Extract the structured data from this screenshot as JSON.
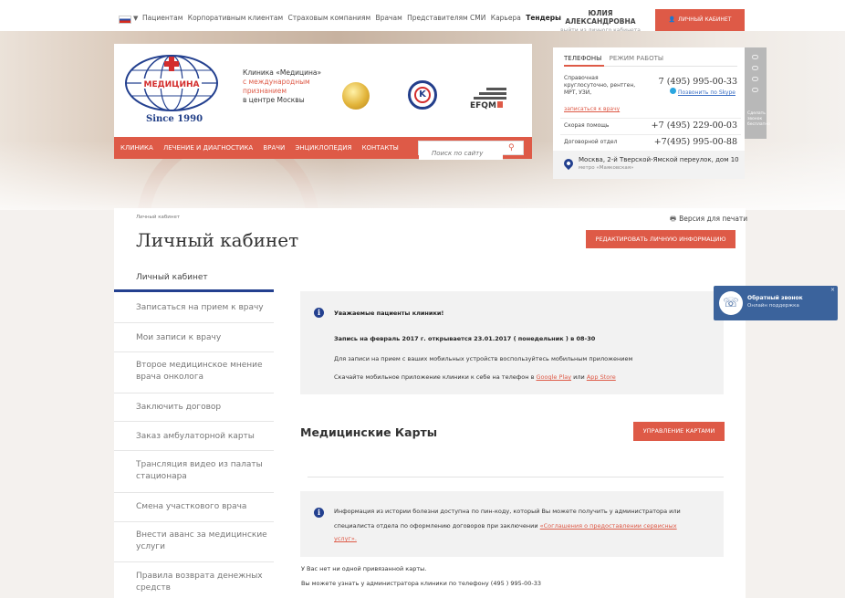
{
  "topbar": {
    "links": [
      "Пациентам",
      "Корпоративным клиентам",
      "Страховым компаниям",
      "Врачам",
      "Представителям СМИ",
      "Карьера"
    ],
    "bold_link": "Тендеры",
    "user_name": "ЮЛИЯ АЛЕКСАНДРОВНА",
    "user_sub": "выйти из личного кабинета",
    "cabinet_button": "ЛИЧНЫЙ КАБИНЕТ"
  },
  "header": {
    "logo_since": "Since 1990",
    "logo_brand": "МЕДИЦИНА",
    "clinic_line1": "Клиника «Медицина»",
    "clinic_line2": "с международным",
    "clinic_line3": "признанием",
    "clinic_line4": "в центре Москвы",
    "badge2_letter": "K",
    "efqm_label": "EFQM",
    "nav": [
      "КЛИНИКА",
      "ЛЕЧЕНИЕ И ДИАГНОСТИКА",
      "ВРАЧИ",
      "ЭНЦИКЛОПЕДИЯ",
      "КОНТАКТЫ"
    ],
    "search_placeholder": "Поиск по сайту"
  },
  "phones": {
    "tab_active": "ТЕЛЕФОНЫ",
    "tab_other": "РЕЖИМ РАБОТЫ",
    "main_label": [
      "Справочная",
      "круглосуточно, рентген,",
      "МРТ, УЗИ,"
    ],
    "main_number": "7 (495) 995-00-33",
    "skype": "Позвонить по Skype",
    "signup": "записаться к врачу",
    "ambulance_label": "Скорая помощь",
    "ambulance_number": "+7 (495) 229-00-03",
    "contract_label": "Договорной отдел",
    "contract_number": "+7(495) 995-00-88",
    "address": "Москва, 2-й Тверской-Ямской переулок, дом 10",
    "metro": "метро «Маяковская»",
    "side_text": "Сделать звонок бесплатно"
  },
  "page": {
    "breadcrumb": "Личный кабинет",
    "print": "Версия для печати",
    "title": "Личный кабинет",
    "edit_button": "РЕДАКТИРОВАТЬ ЛИЧНУЮ ИНФОРМАЦИЮ"
  },
  "menu": [
    "Личный кабинет",
    "Записаться на прием к врачу",
    "Мои записи к врачу",
    "Второе медицинское мнение врача онколога",
    "Заключить договор",
    "Заказ амбулаторной карты",
    "Трансляция видео из палаты стационара",
    "Смена участкового врача",
    "Внести аванс за медицинские услуги",
    "Правила возврата денежных средств"
  ],
  "notice": {
    "heading": "Уважаемые пациенты клиники!",
    "bold_line": "Запись на февраль 2017 г. открывается 23.01.2017 ( понедельник ) в 08-30",
    "line1": "Для записи на прием с ваших мобильных устройств воспользуйтесь мобильным приложением",
    "line2_prefix": "Скачайте мобильное приложение клиники к себе на телефон в",
    "google_play": "Google Play",
    "or": "или",
    "app_store": "App Store"
  },
  "cards": {
    "title": "Медицинские Карты",
    "button": "УПРАВЛЕНИЕ КАРТАМИ",
    "info_line1": "Информация из истории болезни доступна по пин-коду, который Вы можете получить у администратора или",
    "info_line2_prefix": "специалиста отдела по оформлению договоров при заключении",
    "info_link_part1": "«Соглашения о предоставлении сервисных",
    "info_link_part2": "услуг».",
    "no_cards": "У Вас нет ни одной привязанной карты.",
    "learn_phone": "Вы можете узнать у администратора клиники по телефону (495 ) 995-00-33"
  },
  "callback": {
    "title": "Обратный звонок",
    "subtitle": "Онлайн поддержка",
    "close": "×"
  }
}
